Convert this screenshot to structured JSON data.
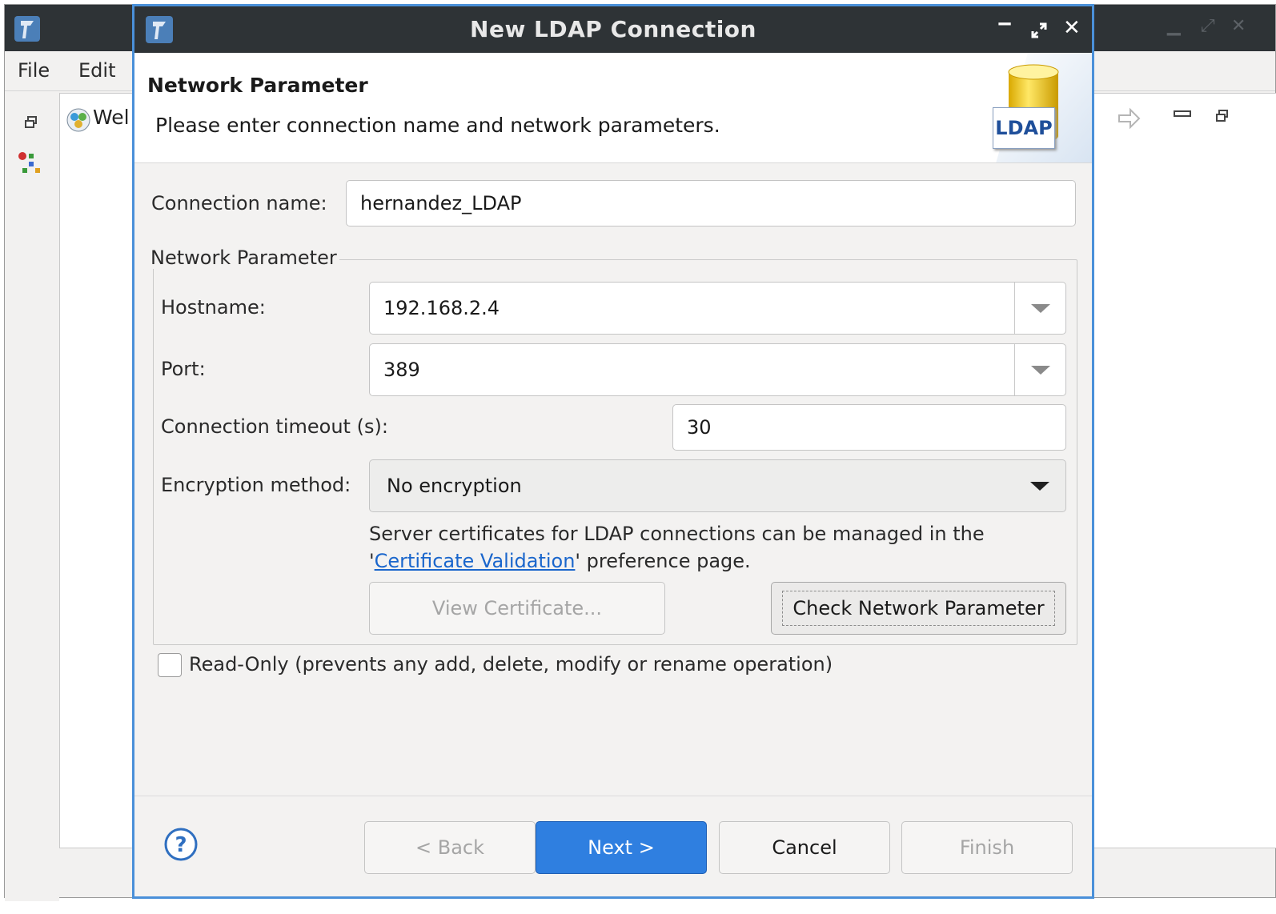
{
  "background_window": {
    "menu": [
      "File",
      "Edit"
    ],
    "tab_label": "Wel"
  },
  "dialog": {
    "title": "New LDAP Connection",
    "header": {
      "title": "Network Parameter",
      "description": "Please enter connection name and network parameters.",
      "logo_text": "LDAP"
    },
    "connection_name": {
      "label": "Connection name:",
      "value": "hernandez_LDAP"
    },
    "network_group": {
      "title": "Network Parameter",
      "hostname": {
        "label": "Hostname:",
        "value": "192.168.2.4"
      },
      "port": {
        "label": "Port:",
        "value": "389"
      },
      "timeout": {
        "label": "Connection timeout (s):",
        "value": "30"
      },
      "encryption": {
        "label": "Encryption method:",
        "value": "No encryption"
      },
      "cert_info_line1": "Server certificates for LDAP connections can be managed in the",
      "cert_info_quote_open": "'",
      "cert_info_link": "Certificate Validation",
      "cert_info_line2_rest": "' preference page.",
      "view_certificate_button": "View Certificate...",
      "check_network_button": "Check Network Parameter"
    },
    "read_only": {
      "label": "Read-Only (prevents any add, delete, modify or rename operation)",
      "checked": false
    },
    "buttons": {
      "back": "< Back",
      "next": "Next >",
      "cancel": "Cancel",
      "finish": "Finish"
    }
  },
  "colors": {
    "titlebar": "#2e3336",
    "accent_blue": "#2f7fe0",
    "link": "#1a66cc",
    "dialog_border": "#4a90d9"
  }
}
